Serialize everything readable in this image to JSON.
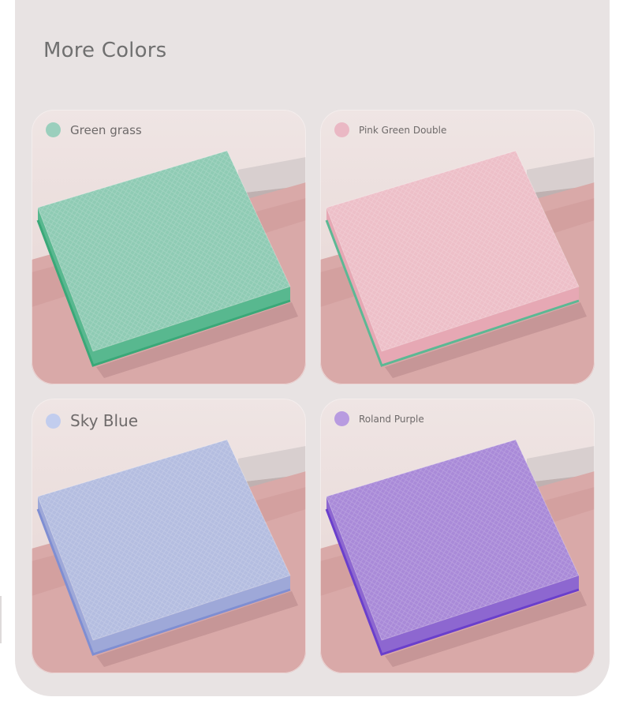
{
  "title": "More Colors",
  "swatches": [
    {
      "name": "Green grass",
      "dot_color": "#9bcfbd",
      "top_color": "#8fcbb4",
      "side_color": "#58b88f",
      "edge_color": "#3aa878"
    },
    {
      "name": "Pink Green Double",
      "dot_color": "#eab8c4",
      "top_color": "#edbfc8",
      "side_color": "#e6a8b4",
      "edge_color": "#5cb894"
    },
    {
      "name": "Sky Blue",
      "dot_color": "#c2cdee",
      "top_color": "#b4bde0",
      "side_color": "#9ea8d8",
      "edge_color": "#7f8ed2"
    },
    {
      "name": "Roland Purple",
      "dot_color": "#b89be0",
      "top_color": "#a98ad8",
      "side_color": "#8d67d0",
      "edge_color": "#6a3fcc"
    }
  ],
  "scene_colors": {
    "wall": "#efe5e4",
    "floor": "#d9a9a8",
    "floor_shade": "#c98e8f",
    "step": "#d8cfcf",
    "border": "#f7f3f3"
  }
}
